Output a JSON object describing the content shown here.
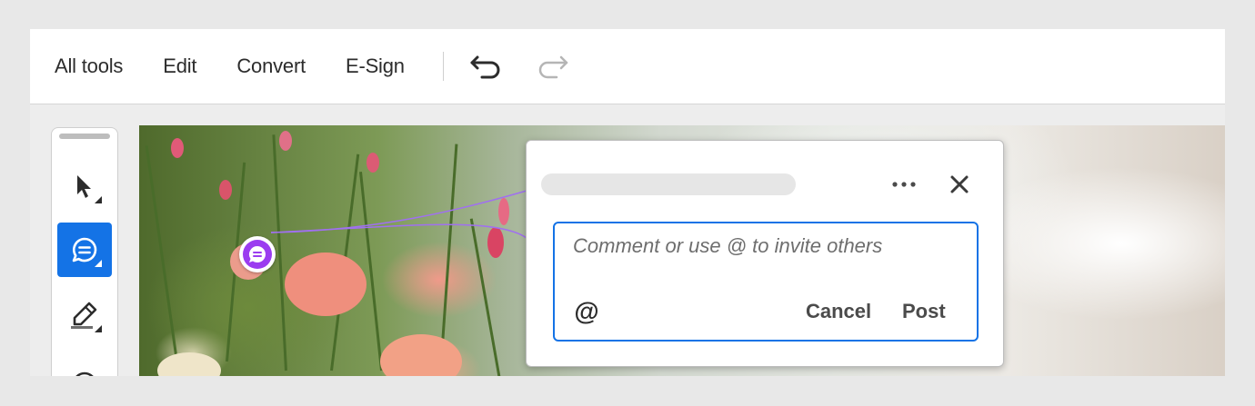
{
  "toolbar": {
    "menu": [
      {
        "label": "All tools"
      },
      {
        "label": "Edit"
      },
      {
        "label": "Convert"
      },
      {
        "label": "E-Sign"
      }
    ],
    "undo_icon": "undo-icon",
    "redo_icon": "redo-icon"
  },
  "left_rail": {
    "tools": [
      {
        "icon": "select-pointer-icon",
        "active": false
      },
      {
        "icon": "add-comment-icon",
        "active": true
      },
      {
        "icon": "highlight-pen-icon",
        "active": false
      }
    ]
  },
  "comment_popover": {
    "input_placeholder": "Comment or use @ to invite others",
    "input_value": "",
    "mention_label": "@",
    "cancel_label": "Cancel",
    "post_label": "Post",
    "more_icon": "more-options-icon",
    "close_icon": "close-icon"
  },
  "colors": {
    "accent": "#1473e6",
    "comment_pin": "#9b3cf0"
  }
}
